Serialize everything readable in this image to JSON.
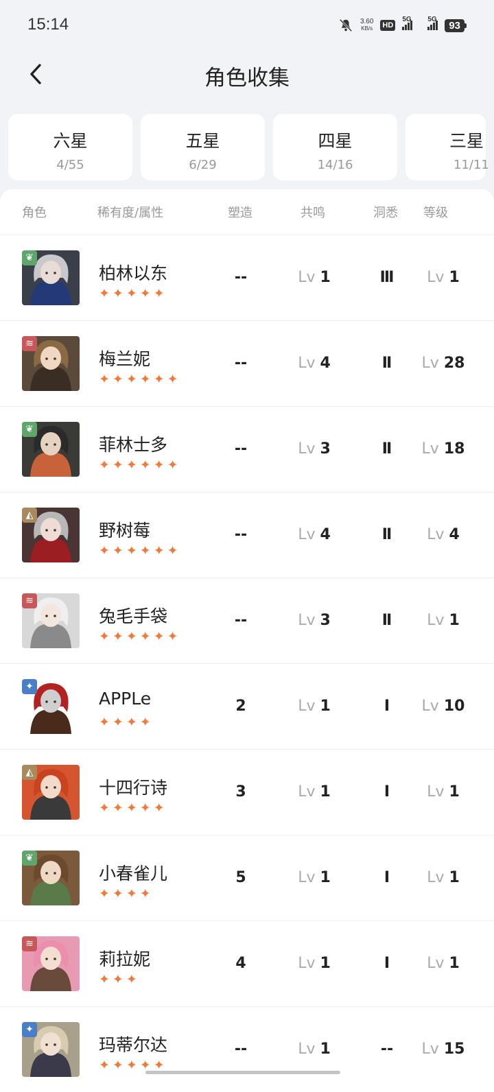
{
  "status": {
    "time": "15:14",
    "net_speed": "3.60",
    "net_unit": "KB/s",
    "hd": "HD",
    "sig1": "5G",
    "sig2": "5G",
    "battery": "93"
  },
  "header": {
    "title": "角色收集"
  },
  "tabs": [
    {
      "label": "六星",
      "count": "4/55"
    },
    {
      "label": "五星",
      "count": "6/29"
    },
    {
      "label": "四星",
      "count": "14/16"
    },
    {
      "label": "三星",
      "count": "11/11"
    }
  ],
  "columns": {
    "role": "角色",
    "rarity": "稀有度/属性",
    "shape": "塑造",
    "resonance": "共鸣",
    "insight": "洞悉",
    "level": "等级"
  },
  "lv_prefix": "Lv",
  "colors": {
    "accent_star": "#ef7a3a",
    "plant": "#5fa66c",
    "beast": "#c8575a",
    "mineral": "#a88a5c",
    "star": "#4a7fc8"
  },
  "characters": [
    {
      "name": "柏林以东",
      "stars": 5,
      "element": "plant-icon",
      "shape": "--",
      "resonance": "1",
      "insight": "Ⅲ",
      "level": "1"
    },
    {
      "name": "梅兰妮",
      "stars": 6,
      "element": "beast-icon",
      "shape": "--",
      "resonance": "4",
      "insight": "Ⅱ",
      "level": "28"
    },
    {
      "name": "菲林士多",
      "stars": 6,
      "element": "plant-icon",
      "shape": "--",
      "resonance": "3",
      "insight": "Ⅱ",
      "level": "18"
    },
    {
      "name": "野树莓",
      "stars": 6,
      "element": "mineral-icon",
      "shape": "--",
      "resonance": "4",
      "insight": "Ⅱ",
      "level": "4"
    },
    {
      "name": "兔毛手袋",
      "stars": 6,
      "element": "beast-icon",
      "shape": "--",
      "resonance": "3",
      "insight": "Ⅱ",
      "level": "1"
    },
    {
      "name": "APPLe",
      "stars": 4,
      "element": "star-icon",
      "shape": "2",
      "resonance": "1",
      "insight": "Ⅰ",
      "level": "10"
    },
    {
      "name": "十四行诗",
      "stars": 5,
      "element": "mineral-icon",
      "shape": "3",
      "resonance": "1",
      "insight": "Ⅰ",
      "level": "1"
    },
    {
      "name": "小春雀儿",
      "stars": 4,
      "element": "plant-icon",
      "shape": "5",
      "resonance": "1",
      "insight": "Ⅰ",
      "level": "1"
    },
    {
      "name": "莉拉妮",
      "stars": 3,
      "element": "beast-icon",
      "shape": "4",
      "resonance": "1",
      "insight": "Ⅰ",
      "level": "1"
    },
    {
      "name": "玛蒂尔达",
      "stars": 5,
      "element": "star-icon",
      "shape": "--",
      "resonance": "1",
      "insight": "--",
      "level": "15"
    }
  ]
}
